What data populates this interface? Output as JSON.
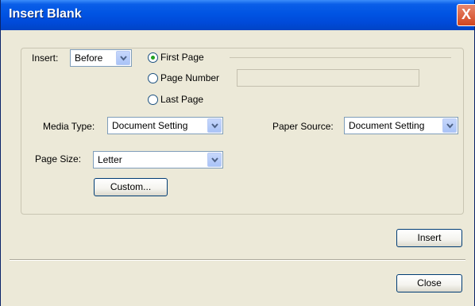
{
  "window": {
    "title": "Insert Blank",
    "close_glyph": "X"
  },
  "insert": {
    "label": "Insert:",
    "position_value": "Before",
    "options": [
      {
        "label": "First Page",
        "selected": true
      },
      {
        "label": "Page Number",
        "selected": false
      },
      {
        "label": "Last Page",
        "selected": false
      }
    ],
    "page_number_value": ""
  },
  "media_type": {
    "label": "Media Type:",
    "value": "Document Setting"
  },
  "paper_source": {
    "label": "Paper Source:",
    "value": "Document Setting"
  },
  "page_size": {
    "label": "Page Size:",
    "value": "Letter"
  },
  "buttons": {
    "custom": "Custom...",
    "insert": "Insert",
    "close": "Close"
  },
  "colors": {
    "title_bar": "#0054e3",
    "dialog_bg": "#ece9d8",
    "radio_dot": "#21a121",
    "close_button": "#d1451f"
  },
  "icons": {
    "dropdown": "chevron-down-icon",
    "close": "close-icon"
  }
}
